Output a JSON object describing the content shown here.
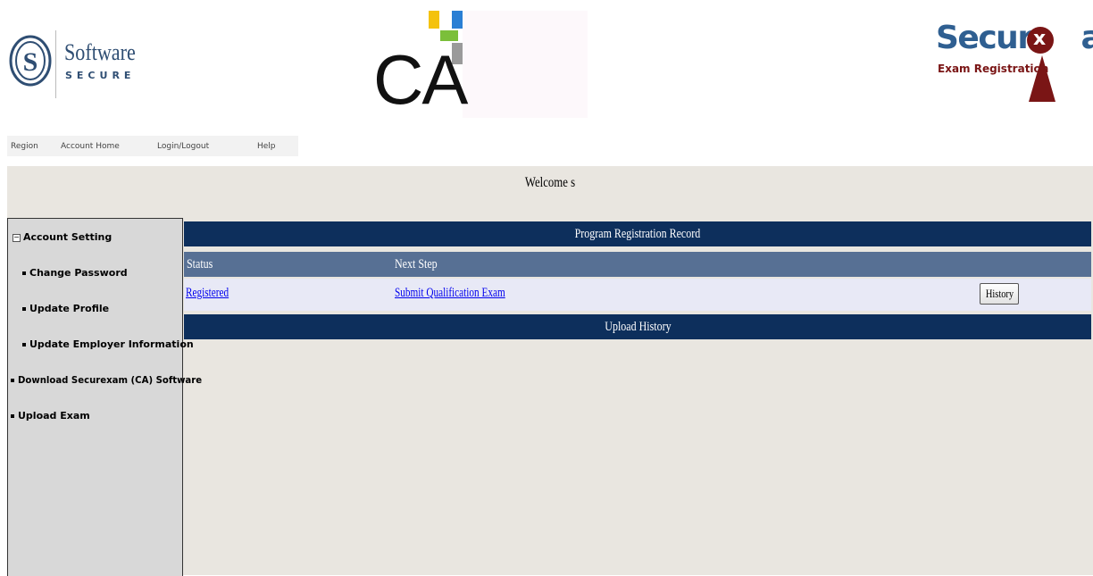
{
  "header": {
    "software_secure_logo": {
      "line1": "Software",
      "line2": "SECURE"
    },
    "ca_logo": {
      "text": "CA"
    },
    "securexam_logo": {
      "word": "Secure",
      "x_letter": "x",
      "word_end": "am",
      "subtitle": "Exam Registration"
    }
  },
  "nav": {
    "items": [
      "Region",
      "Account Home",
      "Login/Logout",
      "Help"
    ]
  },
  "welcome": {
    "text": "Welcome s"
  },
  "sidebar": {
    "items": [
      {
        "label": "Account Setting"
      },
      {
        "label": "Change Password"
      },
      {
        "label": "Update Profile"
      },
      {
        "label": "Update Employer Information"
      },
      {
        "label": "Download Securexam (CA) Software"
      },
      {
        "label": "Upload Exam"
      }
    ]
  },
  "main": {
    "program_title": "Program Registration Record",
    "columns": [
      "Status",
      "Next Step"
    ],
    "row": {
      "status": "Registered",
      "next_step": "Submit Qualification Exam",
      "action": "History"
    },
    "upload_title": "Upload History"
  },
  "colors": {
    "header_bar": "#0d2f5c",
    "column_header": "#577094",
    "row_bg": "#e8e9f6",
    "page_bg": "#e9e6e0",
    "link": "#0000ee"
  }
}
